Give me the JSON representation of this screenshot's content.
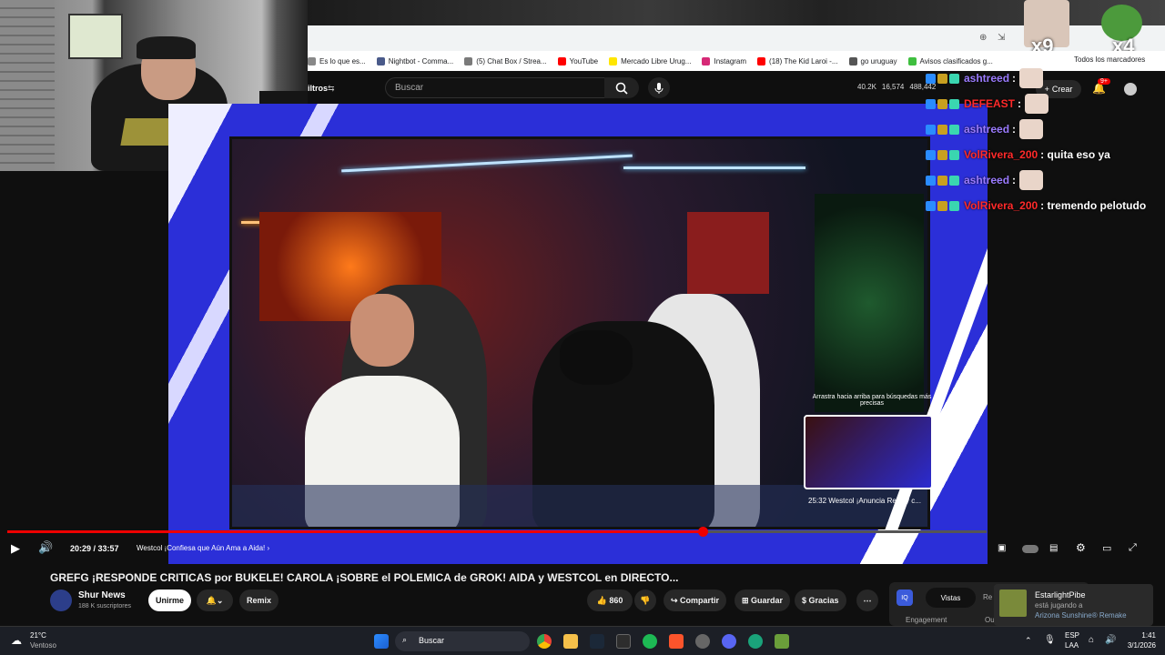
{
  "bookmarks": [
    {
      "label": "Es lo que es...",
      "color": "#888888"
    },
    {
      "label": "Nightbot - Comma...",
      "color": "#4a5a8a"
    },
    {
      "label": "(5) Chat Box / Strea...",
      "color": "#7a7a7a"
    },
    {
      "label": "YouTube",
      "color": "#ff0000"
    },
    {
      "label": "Mercado Libre Urug...",
      "color": "#ffe600"
    },
    {
      "label": "Instagram",
      "color": "#d62976"
    },
    {
      "label": "(18) The Kid Laroi -...",
      "color": "#ff0000"
    },
    {
      "label": "go uruguay",
      "color": "#555555"
    },
    {
      "label": "Avisos clasificados g...",
      "color": "#3fbf3f"
    }
  ],
  "bookmarks_all": "Todos los marcadores",
  "youtube": {
    "filters_label": "iltros",
    "search_placeholder": "Buscar",
    "create_label": "Crear",
    "notif_count": "9+",
    "stats": [
      "40.2K",
      "16,574",
      "488,442"
    ]
  },
  "chat": {
    "lines": [
      {
        "user": "ashtreed",
        "msg": ":",
        "emote": true
      },
      {
        "user": "DEFEAST",
        "msg": ":",
        "emote": true
      },
      {
        "user": "ashtreed",
        "msg": ":",
        "emote": true
      },
      {
        "user": "VolRivera_200",
        "msg": ": quita eso ya",
        "emote": false
      },
      {
        "user": "ashtreed",
        "msg": ":",
        "emote": true
      },
      {
        "user": "VolRivera_200",
        "msg": ": tremendo pelotudo",
        "emote": false
      }
    ],
    "multiplier_left": "x9",
    "multiplier_right": "x4"
  },
  "player": {
    "time": "20:29 / 33:57",
    "chapter": "Westcol ¡Confiesa que Aún Ama a Aida!",
    "progress": 0.71,
    "preview_hint": "Arrastra hacia arriba para búsquedas más precisas",
    "preview_label": "25:32  Westcol ¡Anuncia Reality c..."
  },
  "video": {
    "title": "GREFG ¡RESPONDE CRITICAS por BUKELE! CAROLA ¡SOBRE el POLEMICA de GROK! AIDA y WESTCOL en DIRECTO...",
    "channel": "Shur News",
    "subscribers": "188 K suscriptores",
    "join_label": "Unirme",
    "remix_label": "Remix",
    "likes": "860",
    "share_label": "Compartir",
    "save_label": "Guardar",
    "thanks_label": "Gracias"
  },
  "analytics": {
    "tab_views": "Vistas",
    "tab_re": "Re",
    "engagement": "Engagement",
    "ou": "Ou"
  },
  "notification": {
    "name": "EstarlightPibe",
    "status": "está jugando a",
    "game": "Arizona Sunshine® Remake"
  },
  "taskbar": {
    "weather_temp": "21°C",
    "weather_desc": "Ventoso",
    "search": "Buscar",
    "lang1": "ESP",
    "lang2": "LAA",
    "time": "1:41",
    "date": "3/1/2026"
  },
  "colors": {
    "accent_red": "#ff0000",
    "chat_red": "#ff2a2a",
    "chat_purple": "#9b7bff"
  }
}
